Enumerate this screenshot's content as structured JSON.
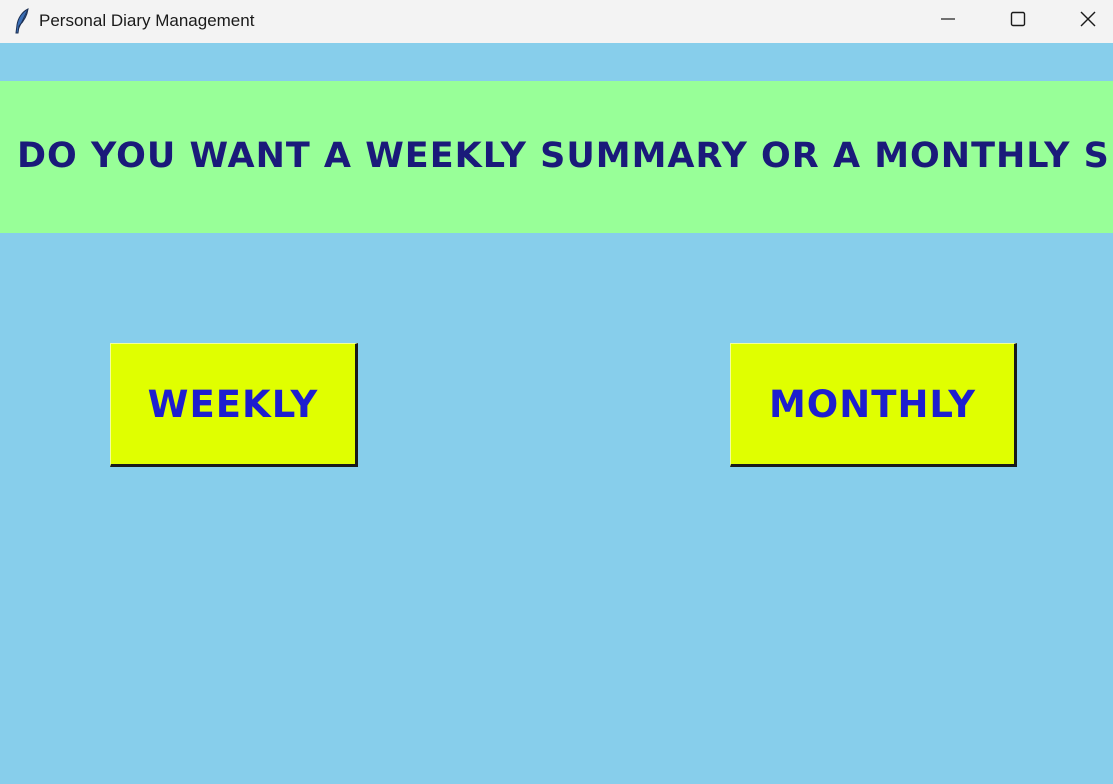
{
  "window": {
    "title": "Personal Diary Management",
    "icon": "feather-icon",
    "controls": {
      "minimize": "minimize-icon",
      "maximize": "maximize-icon",
      "close": "close-icon"
    }
  },
  "banner": {
    "text": "DO YOU WANT A WEEKLY SUMMARY OR A MONTHLY SUMMARY"
  },
  "buttons": {
    "weekly": "WEEKLY",
    "monthly": "MONTHLY"
  },
  "colors": {
    "background": "#87ceeb",
    "banner": "#98ff98",
    "banner_text": "#1a1a7a",
    "button": "#e0ff00",
    "button_text": "#1e1ecf",
    "titlebar": "#f3f3f3"
  }
}
